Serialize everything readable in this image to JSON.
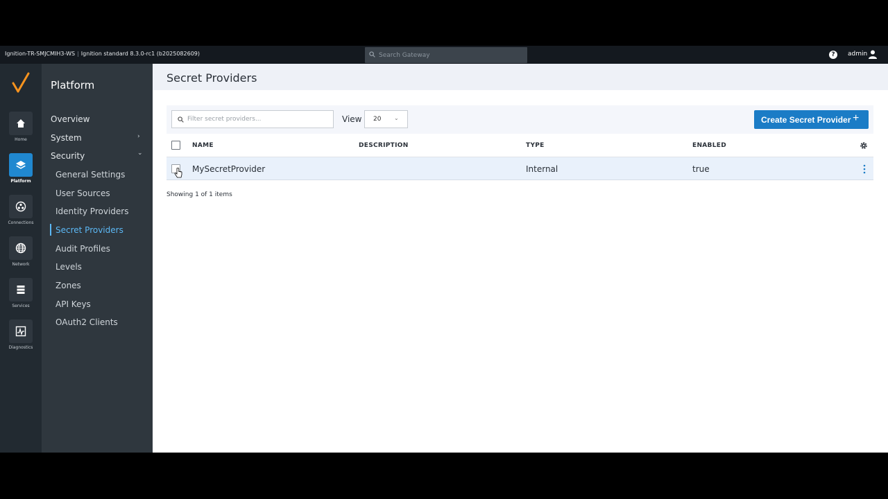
{
  "topbar": {
    "gateway_name": "Ignition-TR-SMJCMIH3-WS",
    "version": "Ignition standard 8.3.0-rc1 (b2025082609)",
    "search_placeholder": "Search Gateway",
    "help": "?",
    "user": "admin"
  },
  "rail": {
    "items": [
      {
        "label": "Home",
        "icon": "home-icon"
      },
      {
        "label": "Platform",
        "icon": "layers-icon",
        "active": true
      },
      {
        "label": "Connections",
        "icon": "connections-icon"
      },
      {
        "label": "Network",
        "icon": "globe-icon"
      },
      {
        "label": "Services",
        "icon": "services-icon"
      },
      {
        "label": "Diagnostics",
        "icon": "diagnostics-icon"
      }
    ]
  },
  "sidenav": {
    "title": "Platform",
    "items": [
      {
        "label": "Overview"
      },
      {
        "label": "System",
        "chevron": "›"
      },
      {
        "label": "Security",
        "chevron": "⌄"
      }
    ],
    "security_items": [
      {
        "label": "General Settings"
      },
      {
        "label": "User Sources"
      },
      {
        "label": "Identity Providers"
      },
      {
        "label": "Secret Providers",
        "active": true
      },
      {
        "label": "Audit Profiles"
      },
      {
        "label": "Levels"
      },
      {
        "label": "Zones"
      },
      {
        "label": "API Keys"
      },
      {
        "label": "OAuth2 Clients"
      }
    ]
  },
  "main": {
    "title": "Secret Providers",
    "filter_placeholder": "Filter secret providers...",
    "view_label": "View",
    "view_value": "20",
    "create_label": "Create Secret Provider",
    "create_plus": "+",
    "columns": [
      "NAME",
      "DESCRIPTION",
      "TYPE",
      "ENABLED"
    ],
    "rows": [
      {
        "name": "MySecretProvider",
        "description": "",
        "type": "Internal",
        "enabled": "true"
      }
    ],
    "showing": "Showing 1 of 1 items"
  },
  "colors": {
    "accent": "#1b7cc6",
    "active_link": "#5cb8f5",
    "rail_bg": "#222a31",
    "sidenav_bg": "#2f373e"
  }
}
